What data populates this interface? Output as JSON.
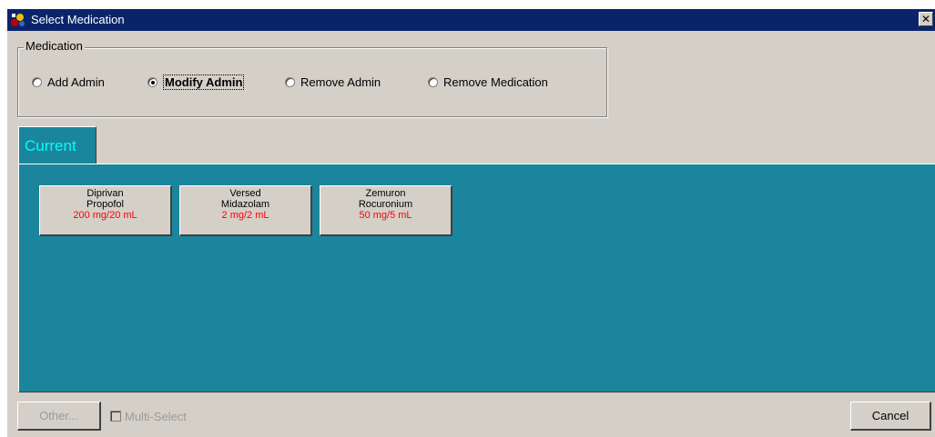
{
  "window": {
    "title": "Select Medication",
    "close_label": "✕"
  },
  "medication_group": {
    "legend": "Medication",
    "options": [
      {
        "label": "Add Admin",
        "checked": false
      },
      {
        "label": "Modify Admin",
        "checked": true
      },
      {
        "label": "Remove Admin",
        "checked": false
      },
      {
        "label": "Remove Medication",
        "checked": false
      }
    ]
  },
  "tabs": [
    {
      "label": "Current"
    }
  ],
  "medications": [
    {
      "brand": "Diprivan",
      "generic": "Propofol",
      "dose": "200 mg/20 mL"
    },
    {
      "brand": "Versed",
      "generic": "Midazolam",
      "dose": "2 mg/2 mL"
    },
    {
      "brand": "Zemuron",
      "generic": "Rocuronium",
      "dose": "50 mg/5 mL"
    }
  ],
  "footer": {
    "other_label": "Other...",
    "multi_select_label": "Multi-Select",
    "multi_select_checked": false,
    "cancel_label": "Cancel"
  },
  "colors": {
    "titlebar": "#0a246a",
    "panel": "#1a859c",
    "tab_text": "#00ffff",
    "dose_text": "#ff0000",
    "dialog_bg": "#d4d0c8"
  },
  "icons": {
    "title": "medication-app-icon",
    "close": "close-icon"
  }
}
